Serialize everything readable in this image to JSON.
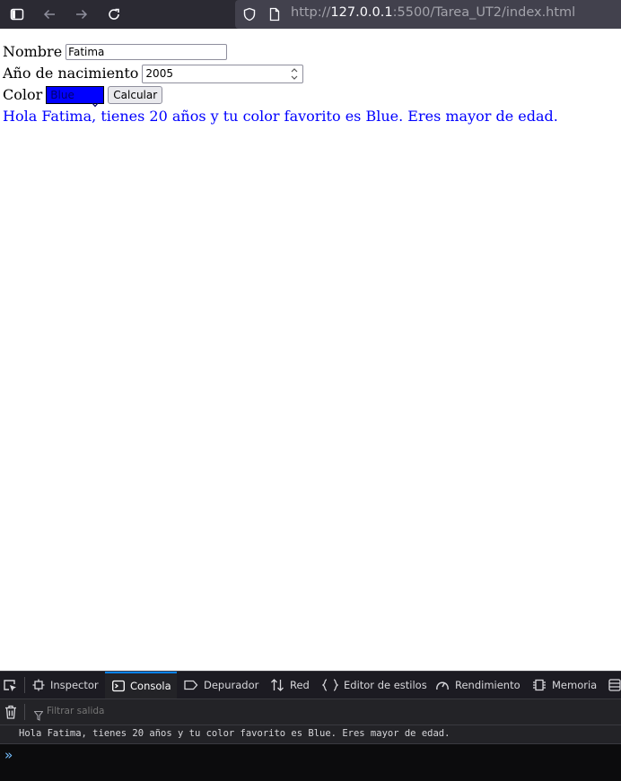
{
  "browser": {
    "url_prefix": "http://",
    "url_host": "127.0.0.1",
    "url_rest": ":5500/Tarea_UT2/index.html",
    "icons": [
      "sidebar-icon",
      "back-icon",
      "forward-icon",
      "reload-icon",
      "shield-icon",
      "page-icon"
    ]
  },
  "form": {
    "nombre_label": "Nombre",
    "nombre_value": "Fatima",
    "anio_label": "Año de nacimiento",
    "anio_value": "2005",
    "color_label": "Color",
    "color_value": "Blue",
    "calcular_label": "Calcular",
    "result": "Hola Fatima, tienes 20 años y tu color favorito es Blue. Eres mayor de edad."
  },
  "devtools": {
    "tabs": [
      {
        "label": "Inspector"
      },
      {
        "label": "Consola"
      },
      {
        "label": "Depurador"
      },
      {
        "label": "Red"
      },
      {
        "label": "Editor de estilos"
      },
      {
        "label": "Rendimiento"
      },
      {
        "label": "Memoria"
      }
    ],
    "filter_placeholder": "Filtrar salida",
    "log": "Hola Fatima, tienes 20 años y tu color favorito es Blue. Eres mayor de edad.",
    "prompt": "»"
  },
  "colors": {
    "result_text": "#0000ff",
    "select_bg": "#0000ff",
    "active_tab_accent": "#0a84ff",
    "devtools_bg": "#232327"
  }
}
